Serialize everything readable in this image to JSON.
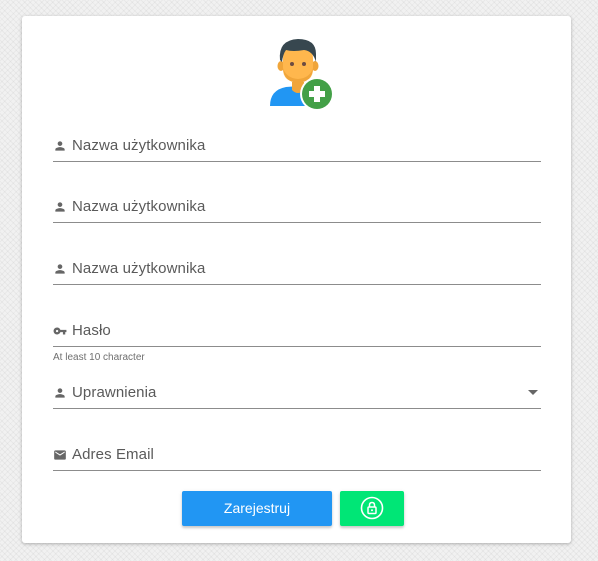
{
  "form": {
    "avatar_icon": "add-user-icon",
    "fields": [
      {
        "icon": "person-icon",
        "label": "Nazwa użytkownika"
      },
      {
        "icon": "person-icon",
        "label": "Nazwa użytkownika"
      },
      {
        "icon": "person-icon",
        "label": "Nazwa użytkownika"
      },
      {
        "icon": "key-icon",
        "label": "Hasło",
        "helper": "At least 10 character"
      },
      {
        "icon": "person-icon",
        "label": "Uprawnienia"
      },
      {
        "icon": "email-icon",
        "label": "Adres Email"
      }
    ],
    "register_label": "Zarejestruj",
    "secondary_button_icon": "lock-icon"
  },
  "colors": {
    "primary": "#2196f3",
    "accent": "#00e676",
    "add_badge": "#43a047",
    "line": "#8c8c8c"
  }
}
